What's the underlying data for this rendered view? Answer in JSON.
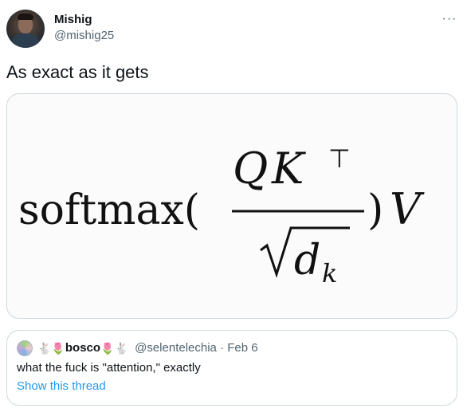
{
  "author": {
    "display_name": "Mishig",
    "handle": "@mishig25",
    "more_icon": "···"
  },
  "tweet": {
    "text": "As exact as it gets"
  },
  "media": {
    "formula": {
      "func": "softmax(",
      "numerator_Q": "Q",
      "numerator_K": "K",
      "transpose": "⊤",
      "denominator_d": "d",
      "subscript_k": "k",
      "close": ")",
      "V": "V"
    }
  },
  "quote": {
    "emoji_before": "🐇🌷",
    "name": "bosco",
    "emoji_after": "🌷🐇",
    "handle": "@selentelechia",
    "separator": "·",
    "date": "Feb 6",
    "text": "what the fuck is \"attention,\" exactly",
    "show_thread": "Show this thread"
  }
}
